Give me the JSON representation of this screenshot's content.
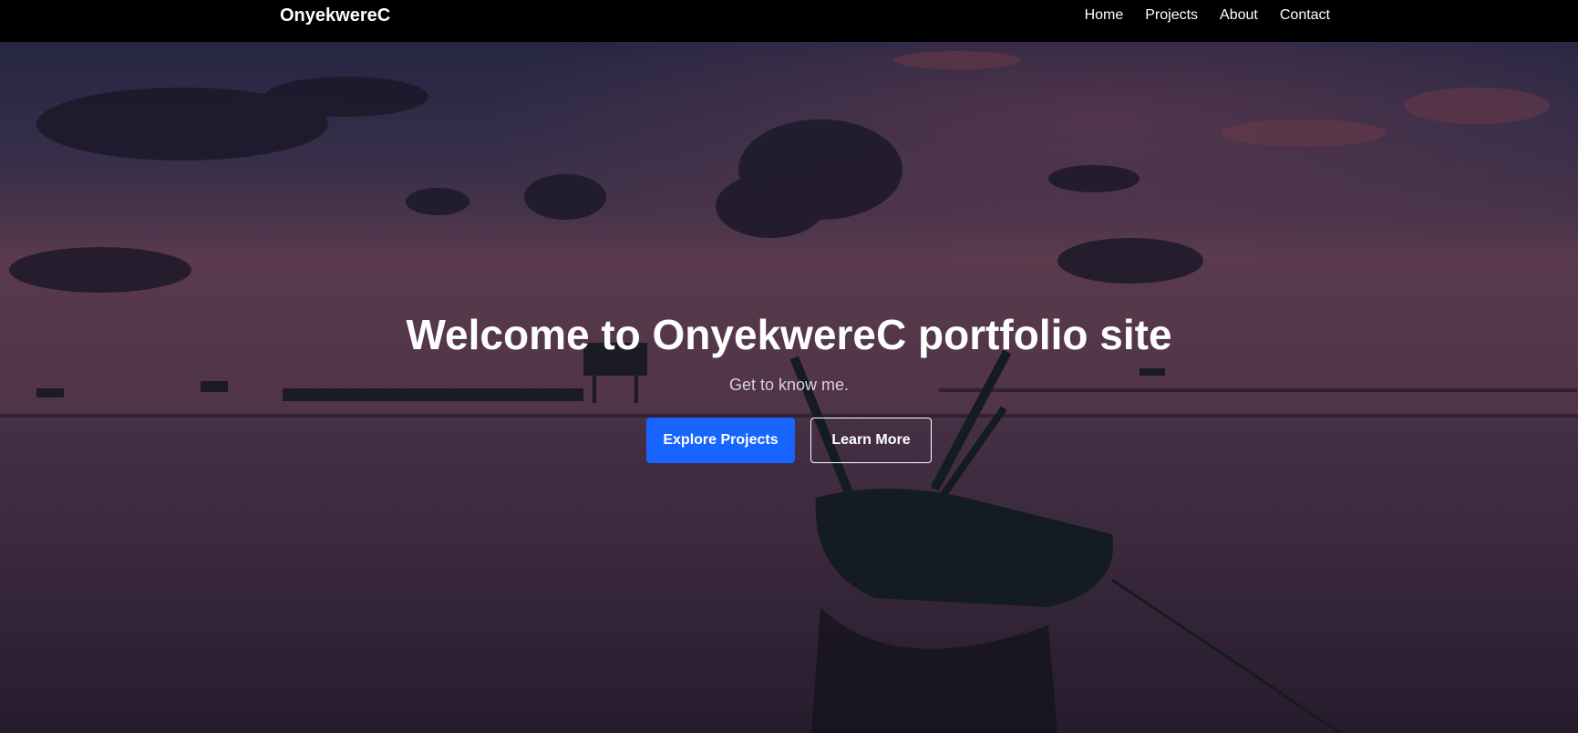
{
  "navbar": {
    "brand": "OnyekwereC",
    "links": [
      "Home",
      "Projects",
      "About",
      "Contact"
    ]
  },
  "hero": {
    "title": "Welcome to OnyekwereC portfolio site",
    "subtitle": "Get to know me.",
    "buttons": {
      "primary": "Explore Projects",
      "secondary": "Learn More"
    },
    "background": "sunset-lake-boat-photo"
  },
  "colors": {
    "navbar_bg": "#000000",
    "primary_button": "#1764ff",
    "text": "#ffffff"
  }
}
